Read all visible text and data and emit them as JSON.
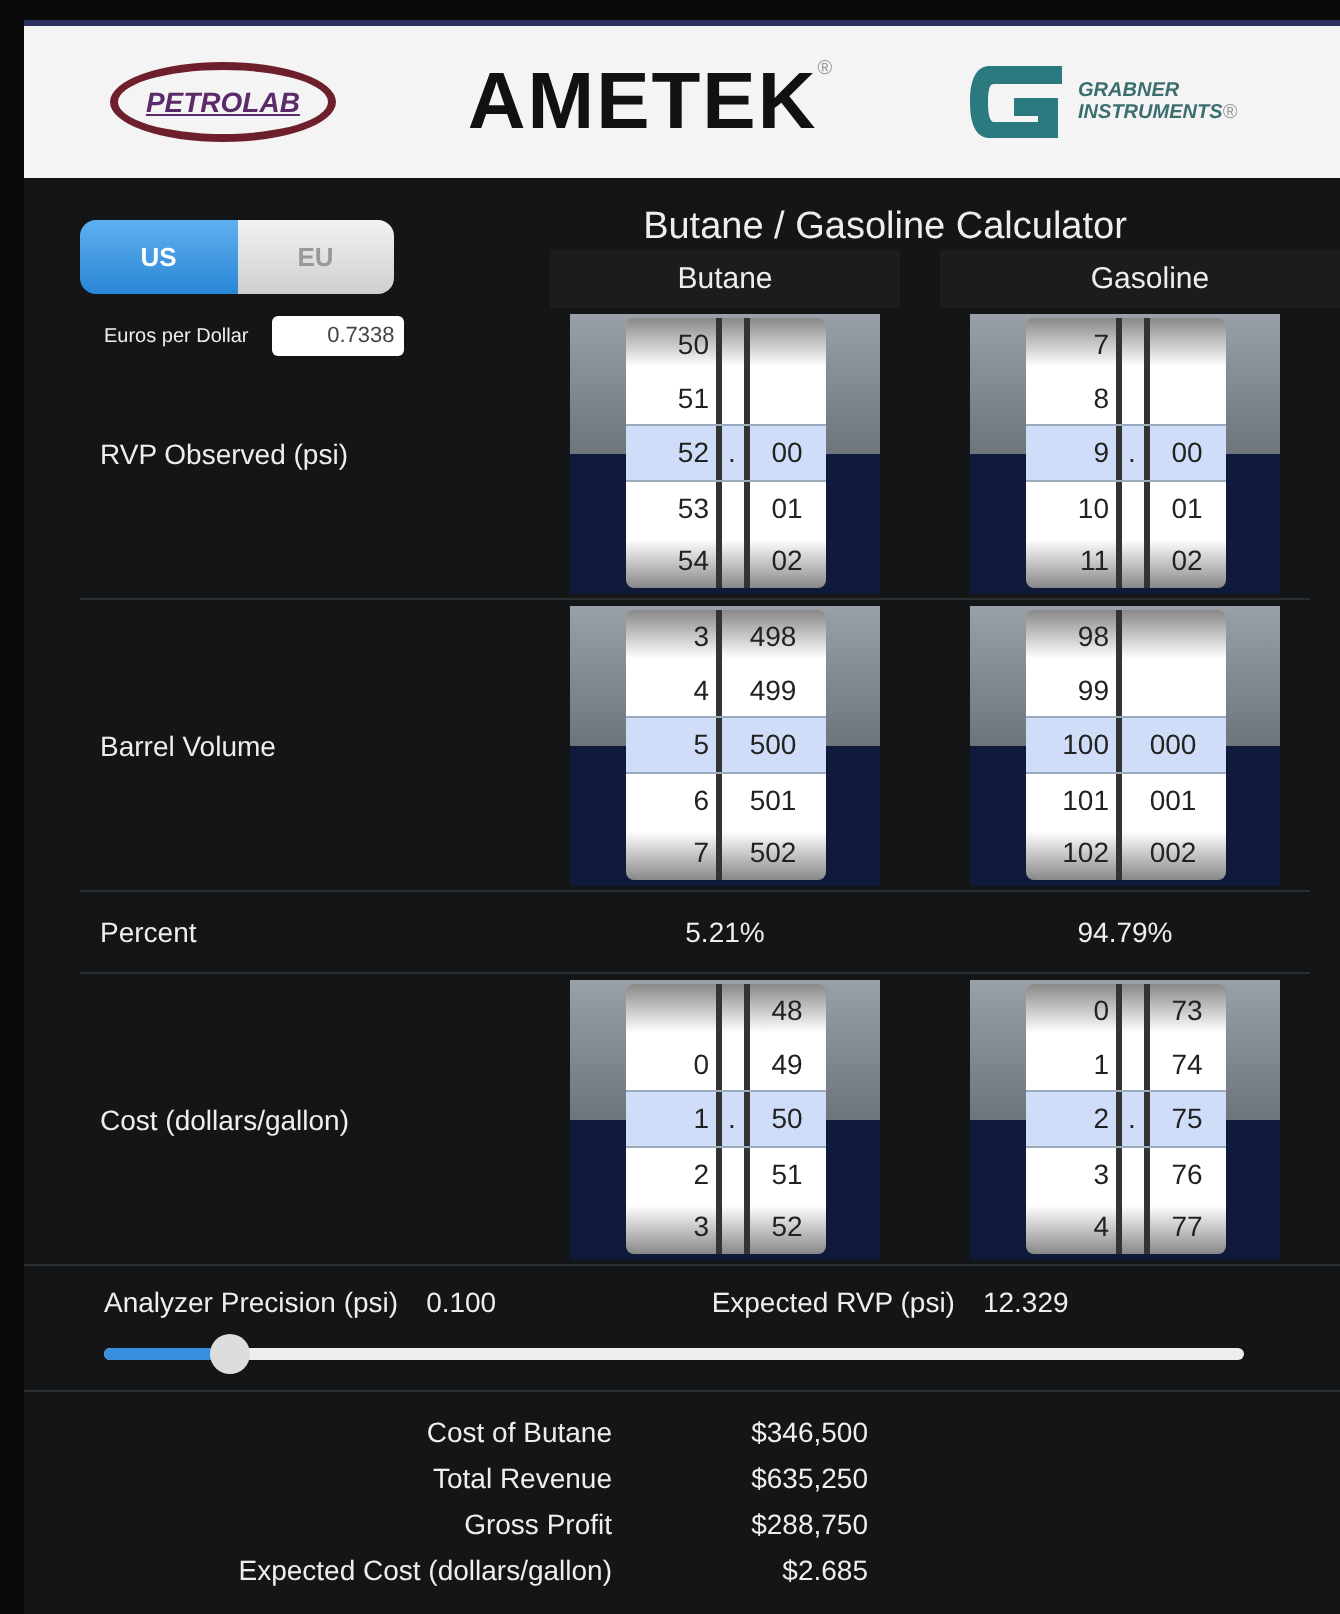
{
  "header": {
    "logos": [
      {
        "kind": "oval",
        "text": "PETROLAB"
      },
      {
        "kind": "wordmark",
        "text": "AMETEK",
        "mark": "®"
      },
      {
        "kind": "badge",
        "text": "GRABNER INSTRUMENTS",
        "mark": "®"
      }
    ]
  },
  "units": [
    {
      "label": "US",
      "selected": true
    },
    {
      "label": "EU",
      "selected": false
    }
  ],
  "title": "Butane / Gasoline Calculator",
  "columns": [
    "Butane",
    "Gasoline"
  ],
  "exchange": {
    "label": "Euros per Dollar",
    "value": "0.7338"
  },
  "rows": [
    {
      "kind": "picker",
      "label": "RVP Observed (psi)",
      "pickers": [
        {
          "kind": "decimal",
          "rows": [
            {
              "whole": "50",
              "selected": false
            },
            {
              "whole": "51",
              "selected": false
            },
            {
              "whole": "52",
              "dot": ".",
              "fraction": "00",
              "selected": true
            },
            {
              "whole": "53",
              "fraction": "01",
              "selected": false
            },
            {
              "whole": "54",
              "fraction": "02",
              "selected": false
            }
          ]
        },
        {
          "kind": "decimal",
          "rows": [
            {
              "whole": "7",
              "selected": false
            },
            {
              "whole": "8",
              "selected": false
            },
            {
              "whole": "9",
              "dot": ".",
              "fraction": "00",
              "selected": true
            },
            {
              "whole": "10",
              "fraction": "01",
              "selected": false
            },
            {
              "whole": "11",
              "fraction": "02",
              "selected": false
            }
          ]
        }
      ]
    },
    {
      "kind": "picker",
      "label": "Barrel Volume",
      "pickers": [
        {
          "kind": "integer",
          "rows": [
            {
              "whole": "3",
              "fraction": "498",
              "selected": false
            },
            {
              "whole": "4",
              "fraction": "499",
              "selected": false
            },
            {
              "whole": "5",
              "fraction": "500",
              "selected": true
            },
            {
              "whole": "6",
              "fraction": "501",
              "selected": false
            },
            {
              "whole": "7",
              "fraction": "502",
              "selected": false
            }
          ]
        },
        {
          "kind": "integer",
          "rows": [
            {
              "whole": "98",
              "selected": false
            },
            {
              "whole": "99",
              "selected": false
            },
            {
              "whole": "100",
              "fraction": "000",
              "selected": true
            },
            {
              "whole": "101",
              "fraction": "001",
              "selected": false
            },
            {
              "whole": "102",
              "fraction": "002",
              "selected": false
            }
          ]
        }
      ]
    },
    {
      "kind": "text",
      "label": "Percent",
      "values": [
        "5.21%",
        "94.79%"
      ]
    },
    {
      "kind": "picker",
      "label": "Cost (dollars/gallon)",
      "pickers": [
        {
          "kind": "decimal",
          "rows": [
            {
              "fraction": "48",
              "selected": false
            },
            {
              "whole": "0",
              "fraction": "49",
              "selected": false
            },
            {
              "whole": "1",
              "dot": ".",
              "fraction": "50",
              "selected": true
            },
            {
              "whole": "2",
              "fraction": "51",
              "selected": false
            },
            {
              "whole": "3",
              "fraction": "52",
              "selected": false
            }
          ]
        },
        {
          "kind": "decimal",
          "rows": [
            {
              "whole": "0",
              "fraction": "73",
              "selected": false
            },
            {
              "whole": "1",
              "fraction": "74",
              "selected": false
            },
            {
              "whole": "2",
              "dot": ".",
              "fraction": "75",
              "selected": true
            },
            {
              "whole": "3",
              "fraction": "76",
              "selected": false
            },
            {
              "whole": "4",
              "fraction": "77",
              "selected": false
            }
          ]
        }
      ]
    }
  ],
  "precision": {
    "label": "Analyzer Precision (psi)",
    "value": "0.100",
    "expected_label": "Expected RVP (psi)",
    "expected_value": "12.329",
    "level": 0.11
  },
  "results": [
    {
      "label": "Cost of Butane",
      "value": "$346,500"
    },
    {
      "label": "Total Revenue",
      "value": "$635,250"
    },
    {
      "label": "Gross Profit",
      "value": "$288,750"
    },
    {
      "label": "Expected Cost (dollars/gallon)",
      "value": "$2.685"
    }
  ]
}
